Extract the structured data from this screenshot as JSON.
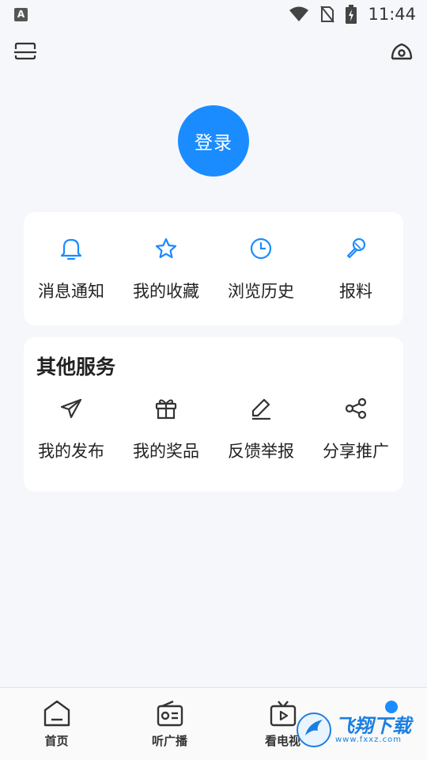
{
  "status_bar": {
    "badge": "A",
    "time": "11:44"
  },
  "login": {
    "label": "登录"
  },
  "quick_actions": [
    {
      "label": "消息通知",
      "icon": "bell-icon"
    },
    {
      "label": "我的收藏",
      "icon": "star-icon"
    },
    {
      "label": "浏览历史",
      "icon": "clock-icon"
    },
    {
      "label": "报料",
      "icon": "microphone-icon"
    }
  ],
  "other_services": {
    "title": "其他服务",
    "items": [
      {
        "label": "我的发布",
        "icon": "paper-plane-icon"
      },
      {
        "label": "我的奖品",
        "icon": "gift-icon"
      },
      {
        "label": "反馈举报",
        "icon": "edit-icon"
      },
      {
        "label": "分享推广",
        "icon": "share-icon"
      }
    ]
  },
  "tabs": [
    {
      "label": "首页",
      "icon": "home-icon"
    },
    {
      "label": "听广播",
      "icon": "radio-icon"
    },
    {
      "label": "看电视",
      "icon": "tv-icon"
    },
    {
      "label": "",
      "icon": "profile-dot-icon"
    }
  ],
  "watermark": {
    "text": "飞翔下载",
    "sub": "www.fxxz.com"
  },
  "colors": {
    "accent": "#1a8cff",
    "background": "#f6f7fa",
    "card": "#ffffff"
  }
}
